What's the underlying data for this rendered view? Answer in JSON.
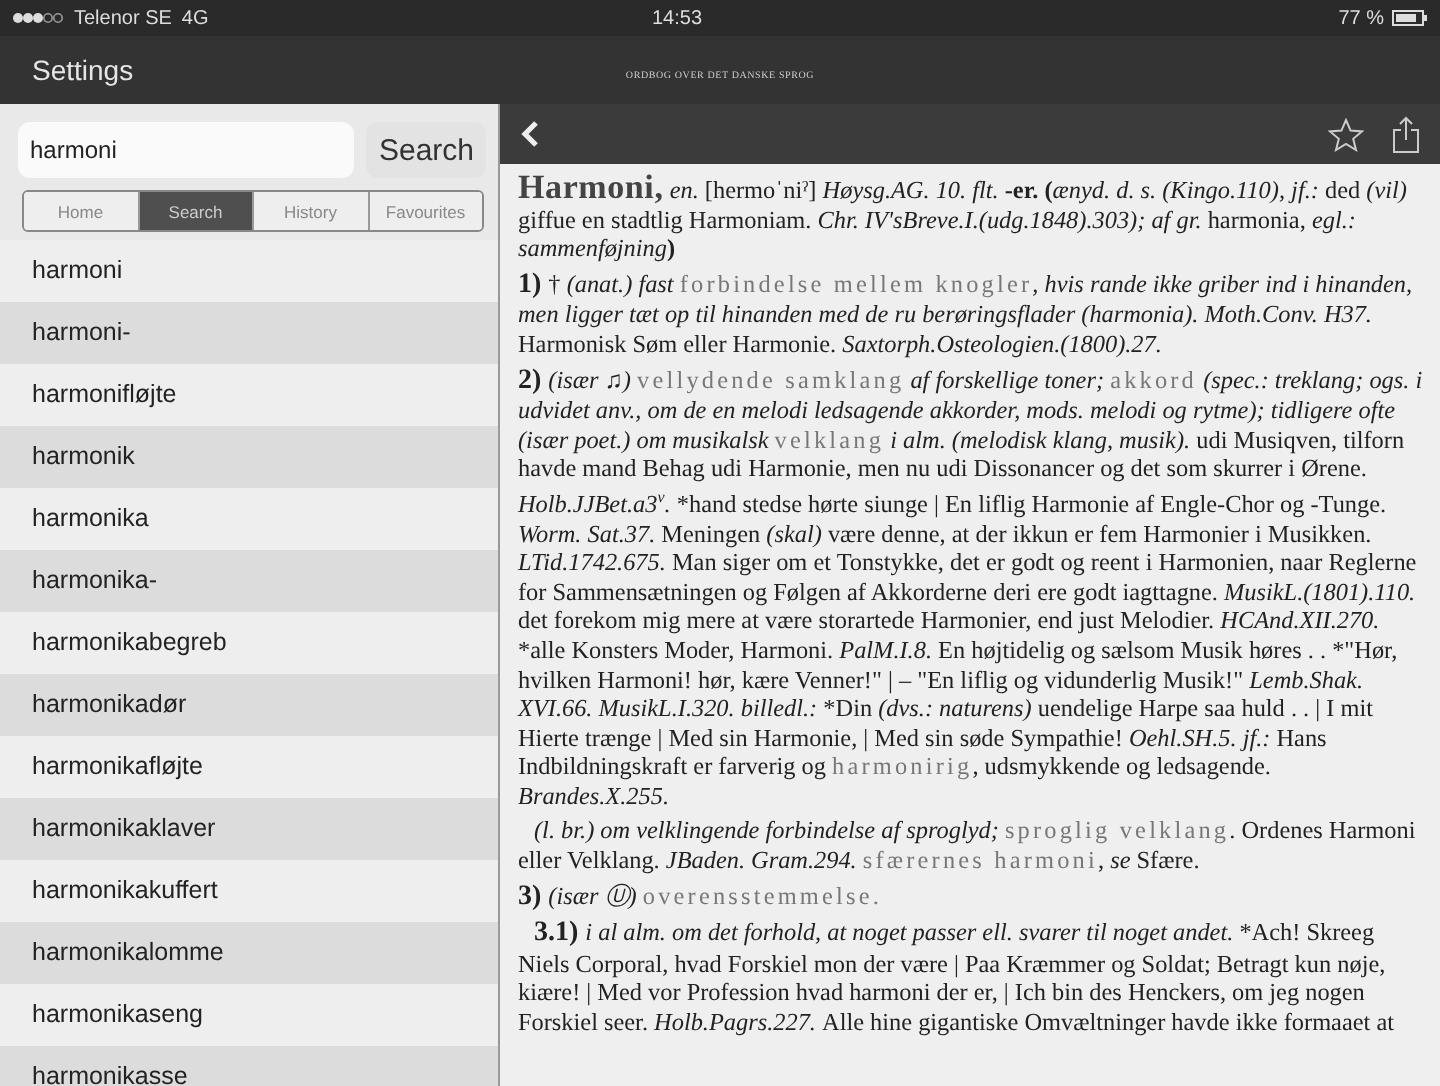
{
  "status_bar": {
    "carrier": "Telenor SE",
    "network": "4G",
    "time": "14:53",
    "battery": "77 %"
  },
  "nav_bar": {
    "left_button": "Settings",
    "logo_title": "ORDBOG OVER DET DANSKE SPROG"
  },
  "sidebar": {
    "search": {
      "value": "harmoni"
    },
    "search_button": "Search",
    "tabs": [
      {
        "label": "Home",
        "selected": false
      },
      {
        "label": "Search",
        "selected": true
      },
      {
        "label": "History",
        "selected": false
      },
      {
        "label": "Favourites",
        "selected": false
      }
    ],
    "results": [
      "harmoni",
      "harmoni-",
      "harmonifløjte",
      "harmonik",
      "harmonika",
      "harmonika-",
      "harmonikabegreb",
      "harmonikadør",
      "harmonikafløjte",
      "harmonikaklaver",
      "harmonikakuffert",
      "harmonikalomme",
      "harmonikaseng",
      "harmonikasse"
    ]
  },
  "entry": {
    "paragraphs": [
      {
        "indented": false,
        "runs": [
          {
            "kind": "h",
            "text": "Harmoni,"
          },
          {
            "kind": "i",
            "text": " en. "
          },
          {
            "kind": "n",
            "text": "[hermoˈniˀ] "
          },
          {
            "kind": "i",
            "text": "Høysg.AG. 10. flt. "
          },
          {
            "kind": "b",
            "text": "-er. ("
          },
          {
            "kind": "i",
            "text": "ænyd. d. s. (Kingo.110), jf.: "
          },
          {
            "kind": "n",
            "text": "ded "
          },
          {
            "kind": "i",
            "text": "(vil) "
          },
          {
            "kind": "n",
            "text": "giffue en stadtlig Harmoniam. "
          },
          {
            "kind": "i",
            "text": "Chr. IV'sBreve.I.(udg.1848).303); af gr. "
          },
          {
            "kind": "n",
            "text": "harmonia, "
          },
          {
            "kind": "i",
            "text": "egl.: sammenføjning"
          },
          {
            "kind": "b",
            "text": ")"
          }
        ]
      },
      {
        "indented": false,
        "runs": [
          {
            "kind": "num",
            "text": "1) "
          },
          {
            "kind": "n",
            "text": "† "
          },
          {
            "kind": "i",
            "text": "(anat.) fast "
          },
          {
            "kind": "s",
            "text": "forbindelse mellem knogler"
          },
          {
            "kind": "i",
            "text": ", hvis rande ikke griber ind i hinanden, men ligger tæt op til hinanden med de ru berøringsflader (harmonia). Moth.Conv. H37. "
          },
          {
            "kind": "n",
            "text": "Harmonisk Søm eller Harmonie. "
          },
          {
            "kind": "i",
            "text": "Saxtorph.Osteologien.(1800).27."
          }
        ]
      },
      {
        "indented": false,
        "runs": [
          {
            "kind": "num",
            "text": "2) "
          },
          {
            "kind": "i",
            "text": "(især ♫) "
          },
          {
            "kind": "s",
            "text": "vellydende samklang"
          },
          {
            "kind": "i",
            "text": " af forskellige toner; "
          },
          {
            "kind": "s",
            "text": "akkord"
          },
          {
            "kind": "i",
            "text": " (spec.: treklang; ogs. i udvidet anv., om de en melodi ledsagende akkorder, mods. melodi og rytme); tidligere ofte (især poet.) om musikalsk "
          },
          {
            "kind": "s",
            "text": "velklang"
          },
          {
            "kind": "i",
            "text": " i alm. (melodisk klang, musik). "
          },
          {
            "kind": "n",
            "text": "udi Musiqven, tilforn havde mand Behag udi Harmonie, men nu udi Dissonancer og det som skurrer i Ørene."
          }
        ]
      },
      {
        "indented": false,
        "runs": [
          {
            "kind": "i",
            "text": "Holb.JJBet.a3"
          },
          {
            "kind": "sup",
            "text": "v"
          },
          {
            "kind": "i",
            "text": ". "
          },
          {
            "kind": "n",
            "text": "*hand stedse hørte siunge | En liflig Harmonie af Engle-Chor og -Tunge. "
          },
          {
            "kind": "i",
            "text": "Worm. Sat.37. "
          },
          {
            "kind": "n",
            "text": "Meningen "
          },
          {
            "kind": "i",
            "text": "(skal) "
          },
          {
            "kind": "n",
            "text": "være denne, at der ikkun er fem Harmonier i Musikken. "
          },
          {
            "kind": "i",
            "text": "LTid.1742.675. "
          },
          {
            "kind": "n",
            "text": "Man siger om et Tonstykke, det er godt og reent i Harmonien, naar Reglerne for Sammensætningen og Følgen af Akkorderne deri ere godt iagttagne. "
          },
          {
            "kind": "i",
            "text": "MusikL.(1801).110. "
          },
          {
            "kind": "n",
            "text": "det forekom mig mere at være storartede Harmonier, end just Melodier. "
          },
          {
            "kind": "i",
            "text": "HCAnd.XII.270. "
          },
          {
            "kind": "n",
            "text": "*alle Konsters Moder, Harmoni. "
          },
          {
            "kind": "i",
            "text": "PalM.I.8. "
          },
          {
            "kind": "n",
            "text": "En højtidelig og sælsom Musik høres . . *\"Hør, hvilken Harmoni! hør, kære Venner!\" | – \"En liflig og vidunderlig Musik!\" "
          },
          {
            "kind": "i",
            "text": "Lemb.Shak. XVI.66. MusikL.I.320. billedl.: "
          },
          {
            "kind": "n",
            "text": "*Din "
          },
          {
            "kind": "i",
            "text": "(dvs.: naturens) "
          },
          {
            "kind": "n",
            "text": "uendelige Harpe saa huld . . | I mit Hierte trænge | Med sin Harmonie, | Med sin søde Sympathie! "
          },
          {
            "kind": "i",
            "text": "Oehl.SH.5. jf.: "
          },
          {
            "kind": "n",
            "text": "Hans Indbildningskraft er farverig og "
          },
          {
            "kind": "s",
            "text": "harmonirig"
          },
          {
            "kind": "n",
            "text": ", udsmykkende og ledsagende. "
          },
          {
            "kind": "i",
            "text": "Brandes.X.255."
          }
        ]
      },
      {
        "indented": true,
        "runs": [
          {
            "kind": "i",
            "text": "(l. br.) om velklingende forbindelse af sproglyd; "
          },
          {
            "kind": "s",
            "text": "sproglig velklang"
          },
          {
            "kind": "n",
            "text": ". Ordenes Harmoni eller Velklang. "
          },
          {
            "kind": "i",
            "text": "JBaden. Gram.294. "
          },
          {
            "kind": "s",
            "text": "sfærernes harmoni"
          },
          {
            "kind": "n",
            "text": ", "
          },
          {
            "kind": "i",
            "text": "se "
          },
          {
            "kind": "n",
            "text": "Sfære."
          }
        ]
      },
      {
        "indented": false,
        "runs": [
          {
            "kind": "num",
            "text": "3) "
          },
          {
            "kind": "i",
            "text": "(især Ⓤ) "
          },
          {
            "kind": "s",
            "text": "overensstemmelse."
          }
        ]
      },
      {
        "indented": true,
        "runs": [
          {
            "kind": "num",
            "text": "3.1) "
          },
          {
            "kind": "i",
            "text": "i al alm. om det forhold, at noget passer ell. svarer til noget andet. "
          },
          {
            "kind": "n",
            "text": "*Ach! Skreeg Niels Corporal, hvad Forskiel mon der være | Paa Kræmmer og Soldat; Betragt kun nøje, kiære! | Med vor Profession hvad harmoni der er, | Ich bin des Henckers, om jeg nogen Forskiel seer. "
          },
          {
            "kind": "i",
            "text": "Holb.Pagrs.227. "
          },
          {
            "kind": "n",
            "text": "Alle hine gigantiske Omvæltninger havde ikke formaaet at"
          }
        ]
      }
    ]
  }
}
